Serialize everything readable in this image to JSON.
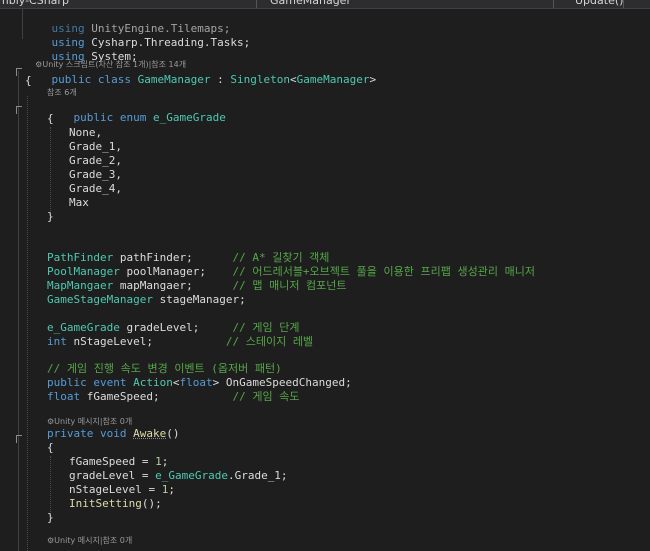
{
  "tabs": {
    "project_label": "mbly-CSharp",
    "file_label": "GameManager",
    "member_label": "Update()"
  },
  "code": {
    "using_kw": "using",
    "using1_ns": "UnityEngine.Tilemaps;",
    "using2_ns": "Cysharp.Threading.Tasks;",
    "using3_ns": "System;",
    "lens_class": "Unity 스크립트(자산 참조 1개)|참조 14개",
    "kw_public": "public",
    "kw_class": "class",
    "class_name": "GameManager",
    "colon": " : ",
    "base_class": "Singleton",
    "lt": "<",
    "gt": ">",
    "brace_open": "{",
    "brace_close": "}",
    "lens_enum": "참조 6개",
    "kw_enum": "enum",
    "enum_name": "e_GameGrade",
    "enum_values": [
      "None,",
      "Grade_1,",
      "Grade_2,",
      "Grade_3,",
      "Grade_4,",
      "Max"
    ],
    "fields": [
      {
        "type": "PathFinder",
        "name": "pathFinder;",
        "comment": "// A* 길찾기 객체"
      },
      {
        "type": "PoolManager",
        "name": "poolManager;",
        "comment": "// 어드레서블+오브젝트 풀을 이용한 프리팹 생성관리 매니저"
      },
      {
        "type": "MapMangaer",
        "name": "mapMangaer;",
        "comment": "// 맵 매니저 컴포넌트"
      },
      {
        "type": "GameStageManager",
        "name": "stageManager;",
        "comment": ""
      }
    ],
    "field_grade_type": "e_GameGrade",
    "field_grade_name": "gradeLevel;",
    "field_grade_comment": "// 게임 단계",
    "kw_int": "int",
    "field_stage_name": "nStageLevel;",
    "field_stage_comment": "// 스테이지 레벨",
    "comment_event": "// 게임 진행 속도 변경 이벤트 (옵저버 패턴)",
    "kw_event": "event",
    "event_type": "Action",
    "kw_float": "float",
    "event_name": "OnGameSpeedChanged;",
    "field_speed_name": "fGameSpeed;",
    "field_speed_comment": "// 게임 속도",
    "lens_method": "Unity 메시지|참조 0개",
    "kw_private": "private",
    "kw_void": "void",
    "method_awake": "Awake",
    "parens": "()",
    "stmt1_name": "fGameSpeed = ",
    "stmt1_val": "1",
    "semicolon": ";",
    "stmt2_name": "gradeLevel = ",
    "stmt2_type": "e_GameGrade",
    "stmt2_member": ".Grade_1;",
    "stmt3_name": "nStageLevel = ",
    "stmt3_val": "1",
    "stmt4_method": "InitSetting",
    "stmt4_tail": "();",
    "lens_method2": "Unity 메시지|참조 0개"
  }
}
